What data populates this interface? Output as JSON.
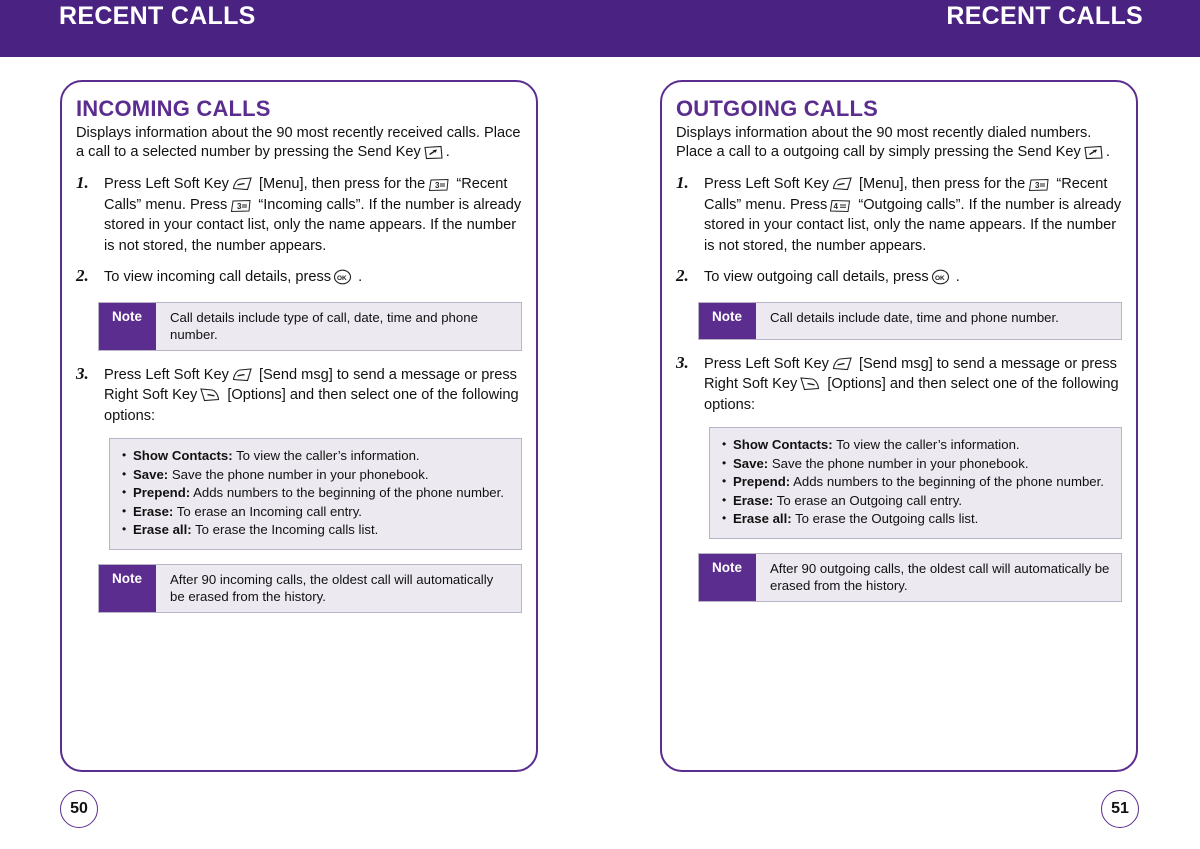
{
  "header": {
    "left_title": "RECENT CALLS",
    "right_title": "RECENT CALLS"
  },
  "colors": {
    "brand_purple": "#4a2382",
    "panel_border": "#5b2d8e",
    "note_bg": "#eceaf0",
    "note_border": "#b9b3c6"
  },
  "left_page": {
    "page_number": "50",
    "section_title": "INCOMING CALLS",
    "intro_part1": "Displays information about the 90 most recently received calls. Place a call to a selected number by pressing the Send Key",
    "intro_part2": ".",
    "steps": [
      {
        "number": "1.",
        "t1": "Press Left Soft Key",
        "t2": "[Menu], then press for the",
        "t3": "“Recent Calls” menu. Press",
        "t4": "“Incoming calls”. If the number is already stored in your contact list, only the name appears. If the number is not stored, the number appears.",
        "key_menu": "3",
        "key_submenu": "3"
      },
      {
        "number": "2.",
        "t1": "To view incoming call details, press",
        "t2": "."
      },
      {
        "number": "3.",
        "t1": "Press Left Soft Key",
        "t2": "[Send msg] to send a message or press Right Soft Key",
        "t3": "[Options] and then select one of the following options:"
      }
    ],
    "note_top": {
      "badge": "Note",
      "text": "Call details include type of call, date, time and phone number."
    },
    "note_bottom": {
      "badge": "Note",
      "text": "After 90 incoming calls, the oldest call will automatically be erased from the history."
    },
    "options": [
      {
        "label": "Show Contacts:",
        "desc": "To view the caller’s information."
      },
      {
        "label": "Save:",
        "desc": "Save the phone number in your phonebook."
      },
      {
        "label": "Prepend:",
        "desc": "Adds numbers to the beginning of the phone number."
      },
      {
        "label": "Erase:",
        "desc": "To erase an Incoming call entry."
      },
      {
        "label": "Erase all:",
        "desc": "To erase the Incoming calls list."
      }
    ]
  },
  "right_page": {
    "page_number": "51",
    "section_title": "OUTGOING CALLS",
    "intro_part1": "Displays information about the 90 most recently dialed numbers. Place a call to a outgoing call by simply pressing the Send Key",
    "intro_part2": ".",
    "steps": [
      {
        "number": "1.",
        "t1": "Press Left Soft Key",
        "t2": "[Menu], then press for the",
        "t3": "“Recent Calls” menu. Press",
        "t4": "“Outgoing calls”. If the number is already stored in your contact list, only the name appears. If the number is not stored, the number appears.",
        "key_menu": "3",
        "key_submenu": "4"
      },
      {
        "number": "2.",
        "t1": "To view outgoing call details, press",
        "t2": "."
      },
      {
        "number": "3.",
        "t1": "Press Left Soft Key",
        "t2": "[Send msg] to send a message or press Right Soft Key",
        "t3": "[Options] and then select one of the following options:"
      }
    ],
    "note_top": {
      "badge": "Note",
      "text": "Call details include date, time and phone number."
    },
    "note_bottom": {
      "badge": "Note",
      "text": "After 90 outgoing calls, the oldest call will automatically be erased from the history."
    },
    "options": [
      {
        "label": "Show Contacts:",
        "desc": "To view the caller’s information."
      },
      {
        "label": "Save:",
        "desc": "Save the phone number in your phonebook."
      },
      {
        "label": "Prepend:",
        "desc": "Adds numbers to the beginning of the phone number."
      },
      {
        "label": "Erase:",
        "desc": "To erase an Outgoing call entry."
      },
      {
        "label": "Erase all:",
        "desc": "To erase the Outgoing calls list."
      }
    ],
    "icons": {
      "send_key": "send-key-icon",
      "left_soft_key": "left-soft-key-icon",
      "right_soft_key": "right-soft-key-icon",
      "ok_key": "ok-key-icon",
      "number_key": "number-key-icon"
    }
  }
}
